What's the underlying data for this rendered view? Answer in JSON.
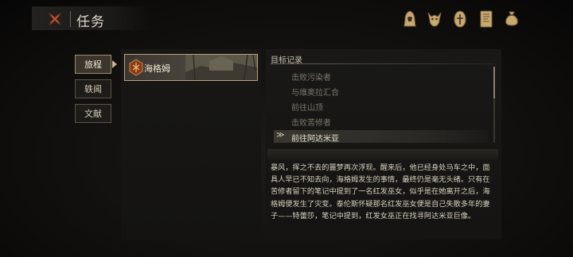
{
  "header": {
    "title": "任务",
    "close_icon": "close-x-icon"
  },
  "top_icons": [
    "hooded-figure-icon",
    "horned-mask-icon",
    "knight-helmet-icon",
    "journal-book-icon",
    "coin-pouch-icon"
  ],
  "tabs": [
    {
      "label": "旅程",
      "active": true
    },
    {
      "label": "轶闻",
      "active": false
    },
    {
      "label": "文献",
      "active": false
    }
  ],
  "quests": [
    {
      "name": "海格姆",
      "selected": true
    }
  ],
  "objectives": {
    "header": "目标记录",
    "completed": [
      "击败污染者",
      "与维奥拉汇合",
      "前往山顶",
      "击败苦修者"
    ],
    "current_marker": "≫",
    "current": "前往阿达米亚"
  },
  "description": "暴风，挥之不去的噩梦再次浮现。醒来后，他已经身处马车之中，面具人早已不知去向，海格姆发生的事情，最终仍是毫无头绪。只有在苦修者留下的笔记中提到了一名红发巫女，似乎是在她离开之后，海格姆便发生了灾变。泰伦斯怀疑那名红发巫女便是自己失散多年的妻子——特蕾莎，笔记中提到，红发女巫正在找寻阿达米亚巨像。",
  "colors": {
    "accent_gold": "#b6a27c",
    "close_red": "#c8502c"
  }
}
